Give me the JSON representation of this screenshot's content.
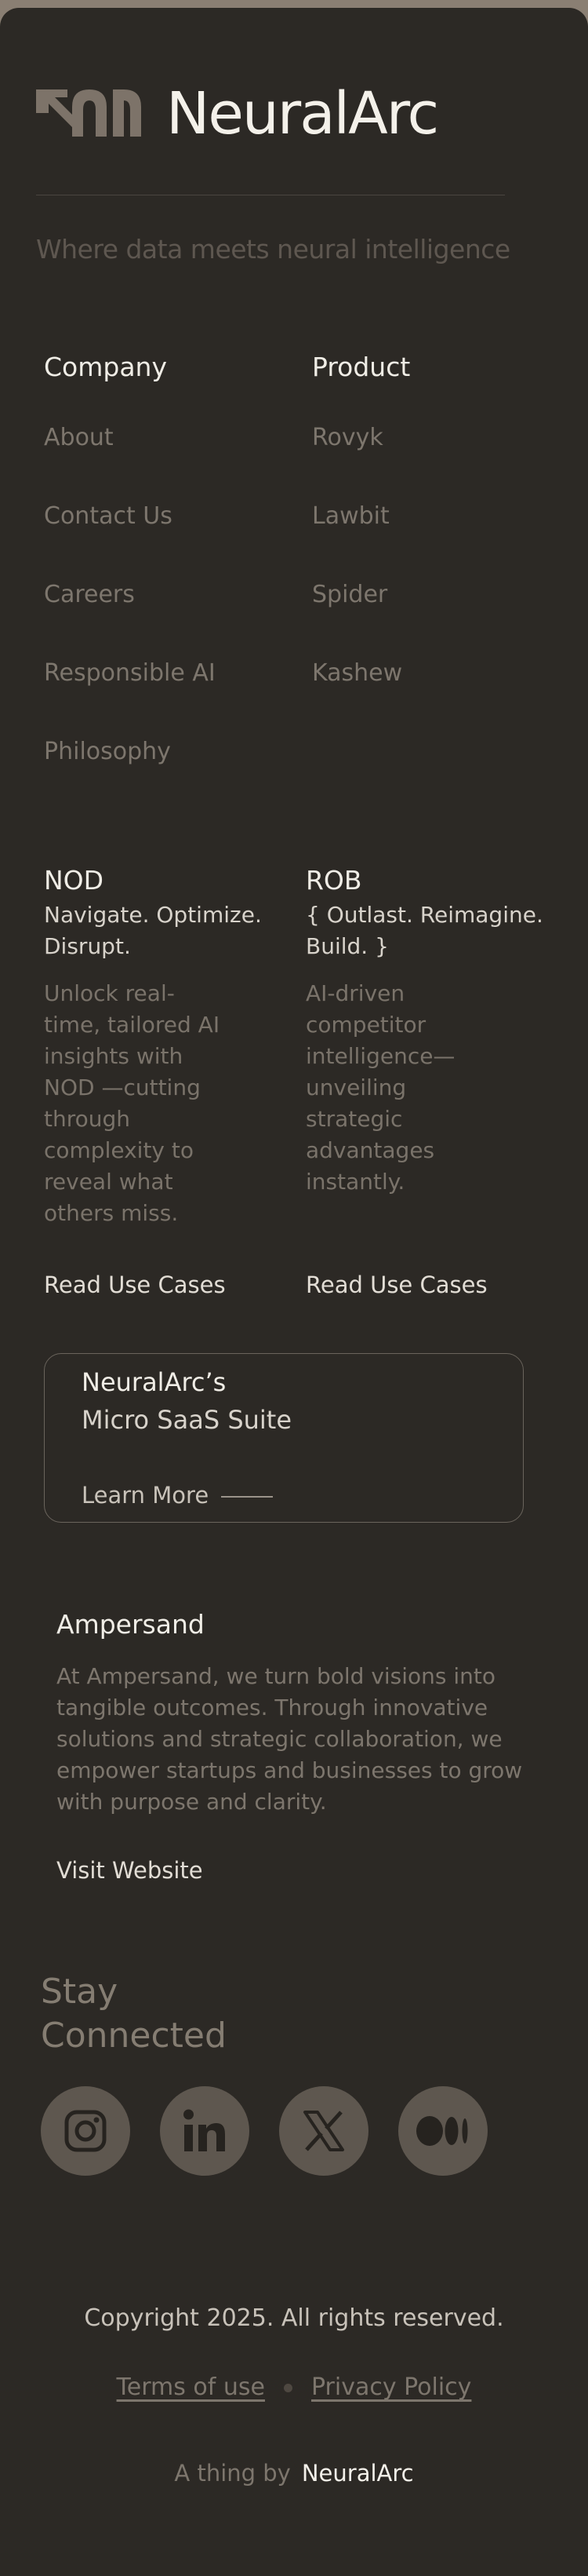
{
  "brand": {
    "name": "NeuralArc",
    "tagline": "Where data meets neural intelligence"
  },
  "company": {
    "title": "Company",
    "links": [
      "About",
      "Contact Us",
      "Careers",
      "Responsible AI",
      "Philosophy"
    ]
  },
  "product": {
    "title": "Product",
    "links": [
      "Rovyk",
      "Lawbit",
      "Spider",
      "Kashew"
    ]
  },
  "products": [
    {
      "name": "NOD",
      "subtitle": [
        "Navigate. Optimize.",
        "Disrupt."
      ],
      "description": [
        "Unlock real-",
        "time, tailored AI",
        "insights with",
        "NOD —cutting",
        "through",
        "complexity to",
        "reveal what",
        "others miss."
      ],
      "cta": "Read Use Cases"
    },
    {
      "name": "ROB",
      "subtitle": [
        "{ Outlast. Reimagine.",
        "Build. }"
      ],
      "description": [
        "AI-driven",
        "competitor",
        "intelligence—",
        "unveiling",
        "strategic",
        "advantages",
        "instantly."
      ],
      "cta": "Read Use Cases"
    }
  ],
  "suite": {
    "line1": "NeuralArc’s",
    "line2": "Micro SaaS Suite",
    "cta": "Learn More"
  },
  "ampersand": {
    "title": "Ampersand",
    "description": [
      "At Ampersand, we turn bold visions into",
      "tangible outcomes. Through innovative",
      "solutions and strategic collaboration, we",
      "empower startups and businesses to grow",
      "with purpose and clarity."
    ],
    "cta": "Visit Website"
  },
  "social": {
    "title": [
      "Stay",
      "Connected"
    ],
    "icons": [
      "instagram-icon",
      "linkedin-icon",
      "x-icon",
      "medium-icon"
    ]
  },
  "legal": {
    "copyright": "Copyright 2025.  All rights reserved.",
    "terms": "Terms of use",
    "privacy": "Privacy Policy",
    "credit_prefix": "A thing by",
    "credit_brand": "NeuralArc"
  },
  "colors": {
    "background": "#2c2925",
    "accent_bar": "#8a7f73",
    "logo": "#7d7369",
    "social_bg": "#5e574f"
  }
}
